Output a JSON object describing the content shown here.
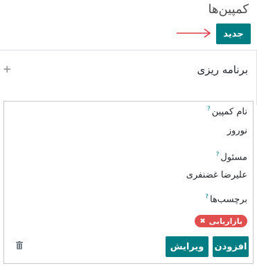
{
  "page": {
    "title": "کمپین‌ها"
  },
  "toolbar": {
    "new_label": "جدید"
  },
  "stage": {
    "title": "برنامه ریزی",
    "add_symbol": "+"
  },
  "card": {
    "name_label": "نام کمپین",
    "name_value": "نوروز",
    "responsible_label": "مسئول",
    "responsible_value": "علیرضا غضنفری",
    "tags_label": "برچسب‌ها",
    "help_mark": "?",
    "tags": [
      "بازاریابی"
    ],
    "add_label": "افزودن",
    "edit_label": "ویرایش"
  },
  "colors": {
    "accent": "#017e84",
    "tag": "#e04e4e",
    "arrow": "#e03a48"
  },
  "icons": [
    "arrow-right-icon",
    "plus-icon",
    "help-icon",
    "remove-tag-icon",
    "trash-icon"
  ]
}
